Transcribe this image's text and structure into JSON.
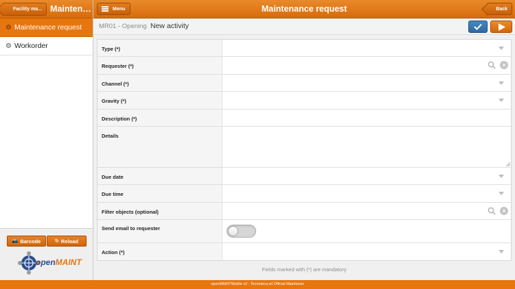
{
  "sidebar": {
    "back_label": "Facility ma...",
    "title": "Maintenance...",
    "items": [
      {
        "label": "Maintenance request",
        "active": true,
        "icon": "gear-icon"
      },
      {
        "label": "Workorder",
        "active": false,
        "icon": "gear-icon"
      }
    ],
    "barcode_label": "Barcode",
    "reload_label": "Reload",
    "logo_text_1": "open",
    "logo_text_2": "MAINT"
  },
  "header": {
    "menu_label": "Menu",
    "title": "Maintenance request",
    "back_label": "Back"
  },
  "subheader": {
    "step": "MR01 - Opening",
    "activity": "New activity"
  },
  "form": {
    "fields": [
      {
        "label": "Type (*)",
        "kind": "select",
        "value": ""
      },
      {
        "label": "Requester (*)",
        "kind": "lookup",
        "value": ""
      },
      {
        "label": "Channel (*)",
        "kind": "select",
        "value": ""
      },
      {
        "label": "Gravity (*)",
        "kind": "select",
        "value": ""
      },
      {
        "label": "Description (*)",
        "kind": "text",
        "value": ""
      },
      {
        "label": "Details",
        "kind": "textarea",
        "value": ""
      },
      {
        "label": "Due date",
        "kind": "select",
        "value": ""
      },
      {
        "label": "Due time",
        "kind": "select",
        "value": ""
      },
      {
        "label": "Filter objects (optional)",
        "kind": "lookup",
        "value": ""
      },
      {
        "label": "Send email to requester",
        "kind": "toggle",
        "value": false
      },
      {
        "label": "Action (*)",
        "kind": "select",
        "value": ""
      }
    ],
    "mandatory_note": "Fields marked with (*) are mandatory"
  },
  "footer": {
    "text": "openMAINTMobile v2 - Tecnoteca srl Official Maintainer"
  },
  "colors": {
    "accent": "#e8760f",
    "save": "#2d6aa3"
  }
}
